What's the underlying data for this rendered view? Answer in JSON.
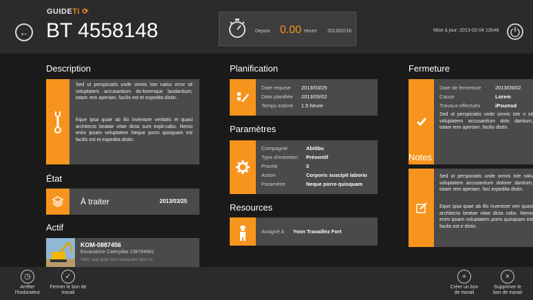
{
  "header": {
    "logo_prefix": "GUIDE",
    "logo_ti": "Ti",
    "title": "BT 4558148",
    "timer": {
      "since_label": "Depuis",
      "hours": "0.00",
      "hours_label": "Heure",
      "date": "2013/02/16"
    },
    "updated": "Mise à jour: 2013-02-04 13h48"
  },
  "description": {
    "title": "Description",
    "para1": "Sed ut perspiciatis unde omnis iste natus error sit voluptatem accusantium do-loremque laudantium, totam rem aperiam. facilis est et expedita distin.",
    "para2": "Eque ipsa quae ab illo inventore veritatis et quasi architecto beatae vitae dicta sunt expli-cabo. Nemo enim ipsam voluptatem Neque porro quisquam est facilis est et expedita distin."
  },
  "etat": {
    "title": "État",
    "status": "À traiter",
    "date": "2013/03/25"
  },
  "actif": {
    "title": "Actif",
    "code": "KOM-0887456",
    "name": "Excavatrice Caterpillar 238794681",
    "desc": "Velit, sed quia non numquam eius m"
  },
  "planification": {
    "title": "Planification",
    "rows": [
      {
        "label": "Date requise",
        "value": "2013/03/25"
      },
      {
        "label": "Date planifiée",
        "value": "2013/05/02"
      },
      {
        "label": "Temps estimé",
        "value": "1.5 heure"
      }
    ]
  },
  "parametres": {
    "title": "Paramètres",
    "rows": [
      {
        "label": "Compagnie",
        "value": "Abitibu"
      },
      {
        "label": "Type d'entretien",
        "value": "Préventif"
      },
      {
        "label": "Priorité",
        "value": "3"
      },
      {
        "label": "Action",
        "value": "Corporis suscipit laborio"
      },
      {
        "label": "Paramètre",
        "value": "Neque porro quisquam"
      }
    ]
  },
  "resources": {
    "title": "Resources",
    "label": "Assigné à",
    "value": "Yvon Travaillez Fort"
  },
  "fermeture": {
    "title": "Fermeture",
    "date_label": "Date de fermeture",
    "date_value": "2013/05/02",
    "cause_label": "Cause",
    "cause_value": "Lorem iPsumsd",
    "travaux_label": "Travaux effectués",
    "text": "Sed ut perspiciatis unde omnis iste n sit voluptatem accusantium dolo dantium, totam rem aperiam. facilis distin."
  },
  "notes": {
    "title": "Notes",
    "para1": "Sed ut perspiciatis unde omnis iste natu voluptatem accusantium dolorer dantium, totam rem aperiam. faci expedita distin.",
    "para2": "Eque ipsa quae ab illo inventore veri quasi architecto beatae vitae dicta cabo. Nemo enim ipsam voluptatem porro quisquam est facilis est e distin."
  },
  "appbar": {
    "stop": "Arrêter l'hodorateur",
    "close": "Fermer le bon de travail",
    "create": "Créer un bon de travail",
    "delete": "Supprimer le bon de travail"
  },
  "colors": {
    "accent": "#f7941d",
    "card": "#4a4a4a",
    "bg": "#1a1a1a"
  }
}
